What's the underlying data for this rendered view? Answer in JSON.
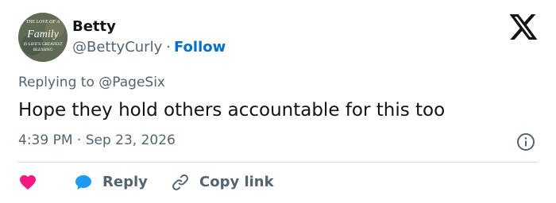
{
  "user": {
    "name": "Betty",
    "handle": "@BettyCurly",
    "separator": "·",
    "follow_label": "Follow",
    "avatar_text": {
      "line1": "THE LOVE OF A",
      "line2": "Family",
      "line3": "IS LIFE'S GREATEST",
      "line4": "BLESSING"
    }
  },
  "tweet": {
    "replying_prefix": "Replying to",
    "replying_to": "@PageSix",
    "text": "Hope they hold others accountable for this too",
    "time": "4:39 PM",
    "date_separator": "·",
    "date": "Sep 23, 2026"
  },
  "actions": {
    "reply_label": "Reply",
    "copy_link_label": "Copy link"
  },
  "icons": {
    "logo": "x-logo-icon",
    "info": "info-icon",
    "like": "heart-icon",
    "reply": "speech-bubble-icon",
    "copy": "link-icon"
  },
  "colors": {
    "text_primary": "#0f1419",
    "text_secondary": "#536471",
    "follow": "#006fd6",
    "heart": "#f91880",
    "reply_bubble": "#1d9bf0",
    "divider": "#cfd9de"
  }
}
